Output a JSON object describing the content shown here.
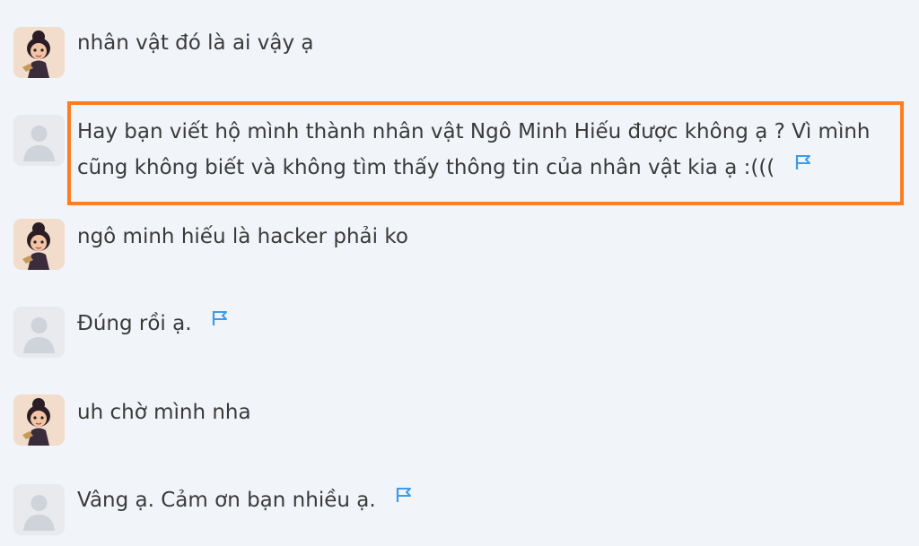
{
  "messages": [
    {
      "sender": "user",
      "text": "nhân vật đó là ai vậy ạ",
      "flag": false
    },
    {
      "sender": "other",
      "lines": [
        "Hay bạn viết hộ mình thành nhân vật Ngô Minh Hiếu được không ạ ? Vì mình",
        "cũng không biết và không tìm thấy thông tin của nhân vật kia ạ :((("
      ],
      "flag": true
    },
    {
      "sender": "user",
      "text": "ngô minh hiếu là hacker phải ko",
      "flag": false
    },
    {
      "sender": "other",
      "text": "Đúng rồi ạ.",
      "flag": true
    },
    {
      "sender": "user",
      "text": "uh chờ mình nha",
      "flag": false
    },
    {
      "sender": "other",
      "text": "Vâng ạ. Cảm ơn bạn nhiều ạ.",
      "flag": true
    }
  ],
  "icons": {
    "flag": "report-flag-icon",
    "user_avatar": "cartoon-girl-avatar",
    "default_avatar": "default-user-avatar"
  },
  "colors": {
    "highlight_border": "#ff7d21",
    "flag": "#3d9bea",
    "background": "#f1f4f9"
  }
}
